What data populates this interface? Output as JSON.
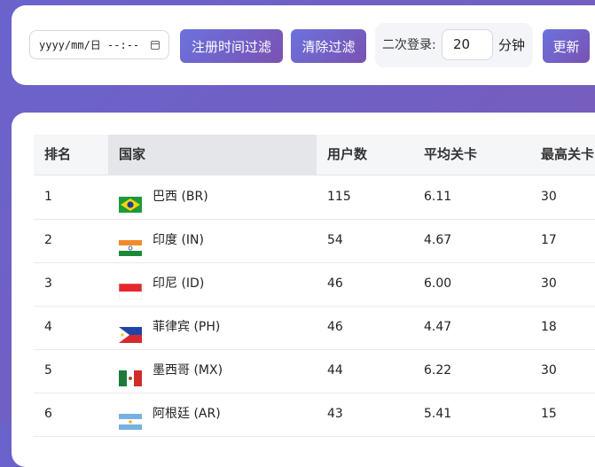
{
  "filters": {
    "date_placeholder": "yyyy/mm/日 --:--",
    "register_filter_label": "注册时间过滤",
    "clear_filter_label": "清除过滤",
    "second_login_label": "二次登录:",
    "minutes_value": "20",
    "minutes_unit": "分钟",
    "update_label": "更新"
  },
  "table": {
    "headers": [
      "排名",
      "国家",
      "用户数",
      "平均关卡",
      "最高关卡"
    ],
    "rows": [
      {
        "rank": "1",
        "flag": "BR",
        "country": "巴西 (BR)",
        "users": "115",
        "avg_level": "6.11",
        "max_level": "30"
      },
      {
        "rank": "2",
        "flag": "IN",
        "country": "印度 (IN)",
        "users": "54",
        "avg_level": "4.67",
        "max_level": "17"
      },
      {
        "rank": "3",
        "flag": "ID",
        "country": "印尼 (ID)",
        "users": "46",
        "avg_level": "6.00",
        "max_level": "30"
      },
      {
        "rank": "4",
        "flag": "PH",
        "country": "菲律宾 (PH)",
        "users": "46",
        "avg_level": "4.47",
        "max_level": "18"
      },
      {
        "rank": "5",
        "flag": "MX",
        "country": "墨西哥 (MX)",
        "users": "44",
        "avg_level": "6.22",
        "max_level": "30"
      },
      {
        "rank": "6",
        "flag": "AR",
        "country": "阿根廷 (AR)",
        "users": "43",
        "avg_level": "5.41",
        "max_level": "15"
      }
    ]
  }
}
